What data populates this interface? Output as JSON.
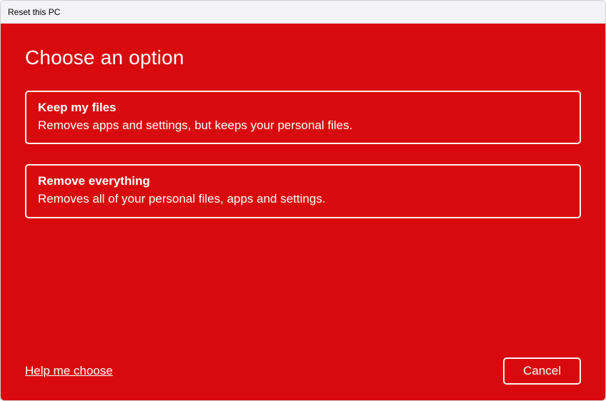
{
  "window": {
    "title": "Reset this PC"
  },
  "main": {
    "heading": "Choose an option",
    "options": [
      {
        "title": "Keep my files",
        "description": "Removes apps and settings, but keeps your personal files."
      },
      {
        "title": "Remove everything",
        "description": "Removes all of your personal files, apps and settings."
      }
    ]
  },
  "footer": {
    "help_link": "Help me choose",
    "cancel_label": "Cancel"
  }
}
